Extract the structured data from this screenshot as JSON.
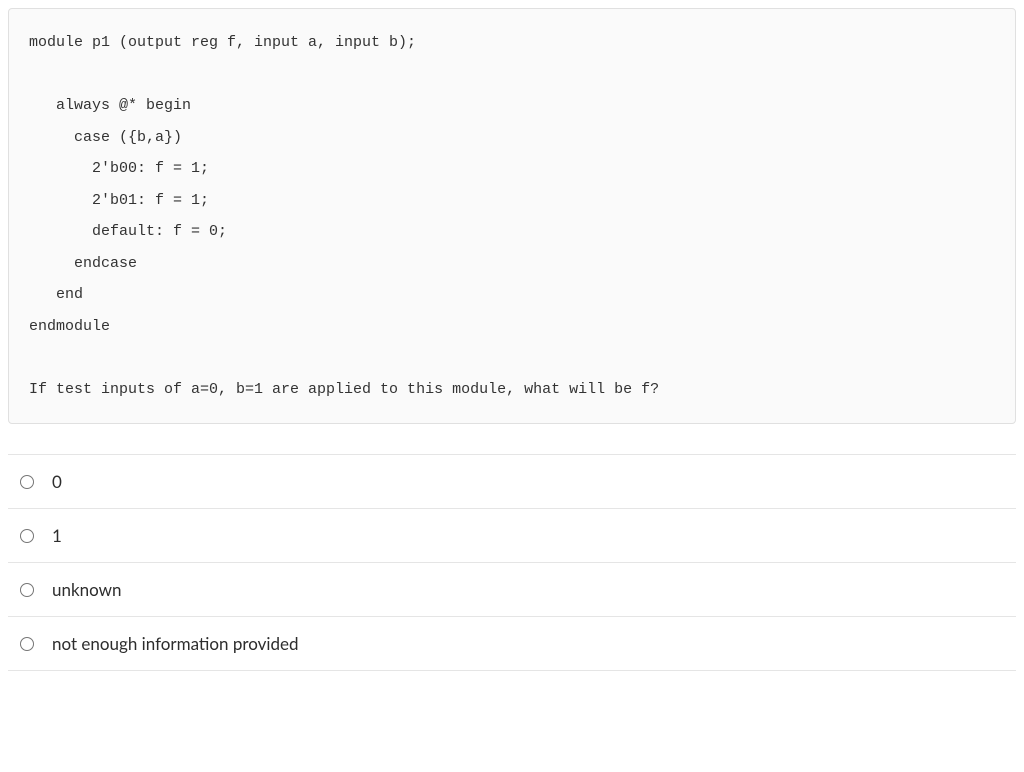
{
  "code": {
    "line1": "module p1 (output reg f, input a, input b);",
    "line2": "",
    "line3": "   always @* begin",
    "line4": "     case ({b,a})",
    "line5": "       2'b00: f = 1;",
    "line6": "       2'b01: f = 1;",
    "line7": "       default: f = 0;",
    "line8": "     endcase",
    "line9": "   end",
    "line10": "endmodule",
    "line11": "",
    "line12": "If test inputs of a=0, b=1 are applied to this module, what will be f?"
  },
  "answers": {
    "a1": "0",
    "a2": "1",
    "a3": "unknown",
    "a4": "not enough information provided"
  }
}
